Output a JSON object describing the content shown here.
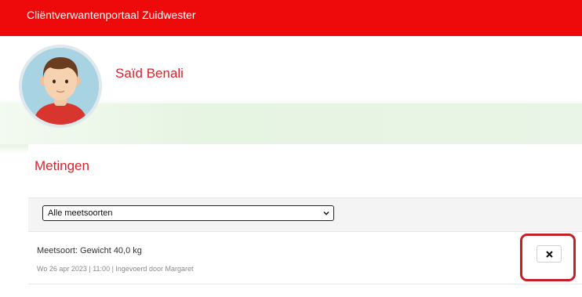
{
  "header": {
    "title": "Cliëntverwantenportaal Zuidwester"
  },
  "profile": {
    "name": "Saïd Benali"
  },
  "measurements": {
    "title": "Metingen",
    "filter": {
      "selected": "Alle meetsoorten"
    },
    "items": [
      {
        "label": "Meetsoort: Gewicht 40,0 kg",
        "meta": "Wo 26 apr 2023 | 11:00 | Ingevoerd door Margaret"
      }
    ]
  },
  "colors": {
    "brand_red": "#ee0a0a",
    "accent_red": "#d9232a",
    "highlight": "#c4202a"
  },
  "icons": {
    "avatar": "user-avatar",
    "dropdown": "chevron-down-icon",
    "delete": "close-icon"
  }
}
